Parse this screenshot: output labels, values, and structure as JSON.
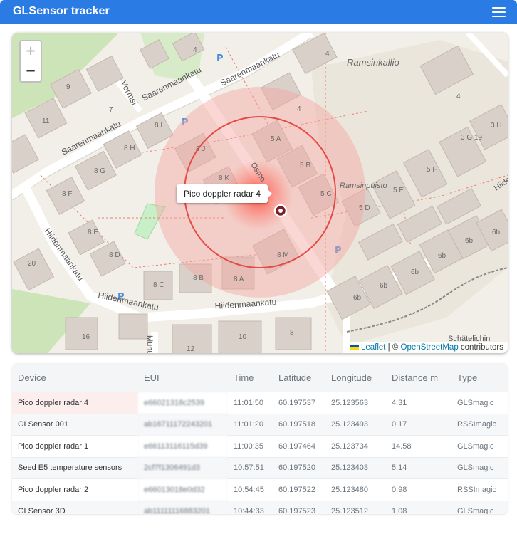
{
  "app": {
    "title": "GLSensor tracker",
    "menu_icon": "hamburger-menu-icon"
  },
  "map": {
    "zoom_in": "+",
    "zoom_out": "−",
    "tooltip": "Pico doppler radar 4",
    "attribution": {
      "leaflet": "Leaflet",
      "separator": " | © ",
      "osm": "OpenStreetMap",
      "suffix": " contributors"
    },
    "labels": {
      "vormsi": "Vormsi",
      "saarenmaankatu": "Saarenmaankatu",
      "hiidenmaankatu": "Hiidenmaankatu",
      "ramsinkallio": "Ramsinkallio",
      "ramsinpuisto": "Ramsinpuisto",
      "muhu": "Muhu",
      "schatelichin": "Schätelichin",
      "osmo": "Osmo",
      "hiide": "Hiide"
    },
    "building_labels": [
      "4",
      "4",
      "4",
      "7",
      "9",
      "11",
      "8 I",
      "8 J",
      "8 H",
      "8 G",
      "8 F",
      "8 K",
      "5 A",
      "5 B",
      "5 C",
      "5 D",
      "5 E",
      "5 F",
      "3 G 19",
      "3 H",
      "20",
      "8 E",
      "8 D",
      "8 C",
      "8 B",
      "8 A",
      "8 M",
      "6b",
      "6b",
      "6b",
      "6b",
      "6b",
      "6b",
      "16",
      "10",
      "8",
      "12",
      "4"
    ],
    "colors": {
      "accuracy_fill": "#f4a6a0",
      "accuracy_ring": "#e64a45",
      "marker": "#7d1f2a"
    }
  },
  "table": {
    "headers": [
      "Device",
      "EUI",
      "Time",
      "Latitude",
      "Longitude",
      "Distance m",
      "Type"
    ],
    "rows": [
      [
        "Pico doppler radar 4",
        "e66021318c2539",
        "11:01:50",
        "60.197537",
        "25.123563",
        "4.31",
        "GLSmagic"
      ],
      [
        "GLSensor 001",
        "ab16711172243201",
        "11:01:20",
        "60.197518",
        "25.123493",
        "0.17",
        "RSSImagic"
      ],
      [
        "Pico doppler radar 1",
        "e66113116115d39",
        "11:00:35",
        "60.197464",
        "25.123734",
        "14.58",
        "GLSmagic"
      ],
      [
        "Seed E5 temperature sensors",
        "2cf7f1306491d3",
        "10:57:51",
        "60.197520",
        "25.123403",
        "5.14",
        "GLSmagic"
      ],
      [
        "Pico doppler radar 2",
        "e66013018e0d32",
        "10:54:45",
        "60.197522",
        "25.123480",
        "0.98",
        "RSSImagic"
      ],
      [
        "GLSensor 3D",
        "ab11111116883201",
        "10:44:33",
        "60.197523",
        "25.123512",
        "1.08",
        "GLSmagic"
      ]
    ]
  }
}
